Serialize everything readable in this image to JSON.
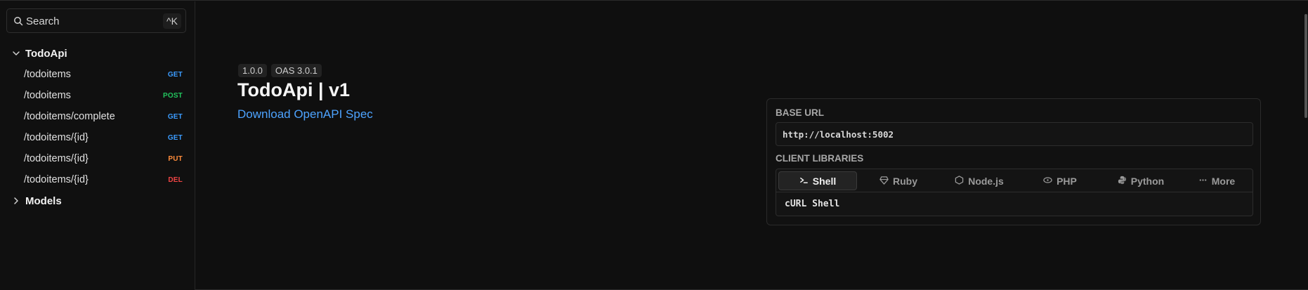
{
  "colors": {
    "get": "#3b9cff",
    "post": "#22c55e",
    "put": "#ff8c3b",
    "del": "#ef4444",
    "link": "#4da3ff"
  },
  "sidebar": {
    "search": {
      "label": "Search",
      "shortcut": "^K",
      "icon": "search-icon"
    },
    "groups": [
      {
        "label": "TodoApi",
        "expanded": true,
        "icon": "chevron-down-icon"
      },
      {
        "label": "Models",
        "expanded": false,
        "icon": "chevron-right-icon"
      }
    ],
    "endpoints": [
      {
        "path": "/todoitems",
        "method": "GET"
      },
      {
        "path": "/todoitems",
        "method": "POST"
      },
      {
        "path": "/todoitems/complete",
        "method": "GET"
      },
      {
        "path": "/todoitems/{id}",
        "method": "GET"
      },
      {
        "path": "/todoitems/{id}",
        "method": "PUT"
      },
      {
        "path": "/todoitems/{id}",
        "method": "DEL"
      }
    ]
  },
  "main": {
    "version_badge": "1.0.0",
    "spec_badge": "OAS 3.0.1",
    "title": "TodoApi | v1",
    "download_link": "Download OpenAPI Spec"
  },
  "card": {
    "base_url_label": "BASE URL",
    "base_url": "http://localhost:5002",
    "client_libraries_label": "CLIENT LIBRARIES",
    "tabs": [
      {
        "label": "Shell",
        "icon": "terminal-icon",
        "active": true
      },
      {
        "label": "Ruby",
        "icon": "ruby-icon",
        "active": false
      },
      {
        "label": "Node.js",
        "icon": "nodejs-icon",
        "active": false
      },
      {
        "label": "PHP",
        "icon": "php-icon",
        "active": false
      },
      {
        "label": "Python",
        "icon": "python-icon",
        "active": false
      },
      {
        "label": "More",
        "icon": "more-icon",
        "active": false
      }
    ],
    "selected_client": "cURL Shell"
  }
}
